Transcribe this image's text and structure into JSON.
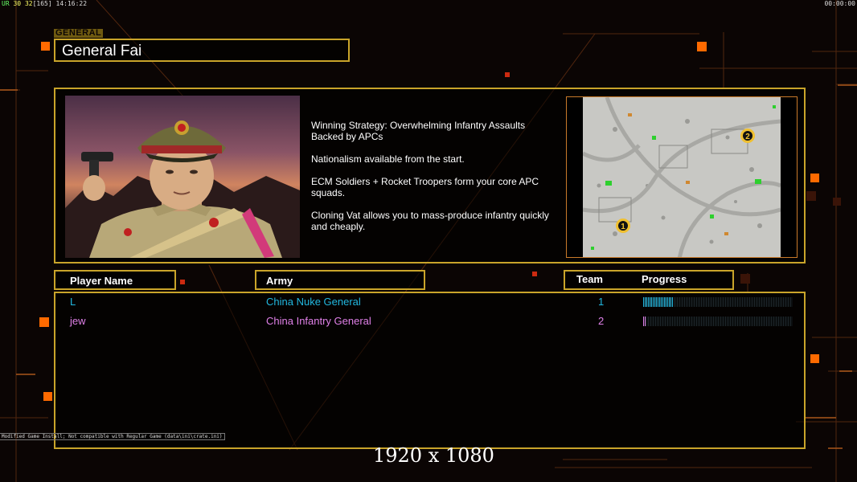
{
  "hud": {
    "prefix": "UR",
    "fps": "30",
    "fps2": "32",
    "frame": "[165]",
    "time": "14:16:22",
    "clock": "00:00:00"
  },
  "general": {
    "tag": "GENERAL",
    "name": "General Fai"
  },
  "strategy": [
    "Winning Strategy: Overwhelming Infantry Assaults\n Backed by APCs",
    "Nationalism available from the start.",
    "ECM Soldiers + Rocket Troopers form your core APC\n squads.",
    "Cloning Vat allows you to mass-produce infantry quickly\n and cheaply."
  ],
  "map": {
    "markers": [
      "1",
      "2"
    ]
  },
  "table": {
    "headers": {
      "player": "Player Name",
      "army": "Army",
      "team": "Team",
      "progress": "Progress"
    },
    "rows": [
      {
        "player": "L",
        "army": "China Nuke General",
        "team": "1",
        "progress": 0.2,
        "color": "#22b8e0"
      },
      {
        "player": "jew",
        "army": "China Infantry General",
        "team": "2",
        "progress": 0.02,
        "color": "#e080e8"
      }
    ]
  },
  "footer": {
    "mod_note": "Modified Game Install; Not compatible with Regular Game (data\\ini\\crate.ini)",
    "resolution": "1920 x 1080"
  },
  "colors": {
    "border": "#c9a42a",
    "accent_orange": "#ff6a00",
    "player1": "#22b8e0",
    "player2": "#e080e8"
  }
}
